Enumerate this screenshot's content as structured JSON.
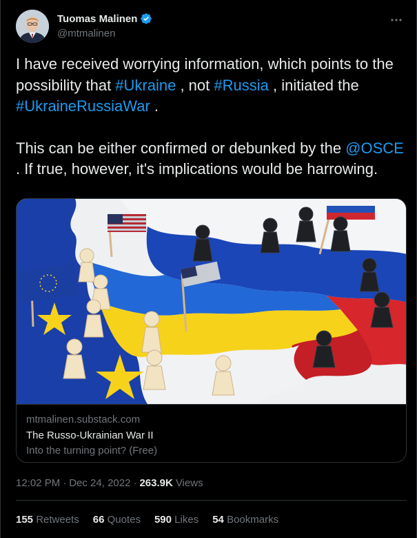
{
  "author": {
    "display_name": "Tuomas Malinen",
    "handle": "@mtmalinen",
    "avatar_icon": "profile-photo",
    "verified_icon": "verified-badge-icon"
  },
  "tweet": {
    "p1_before_ukraine": "I have received worrying information, which points to the possibility that ",
    "hashtag_ukraine": "#Ukraine",
    "p1_between": " , not ",
    "hashtag_russia": "#Russia",
    "p1_after_russia": " , initiated the ",
    "hashtag_war": "#UkraineRussiaWar",
    "p1_end": " .",
    "p2_before_mention": "This can be either confirmed or debunked by the ",
    "mention_osce": "@OSCE",
    "p2_after_mention": " . If true, however, it's implications would  be harrowing."
  },
  "card": {
    "domain": "mtmalinen.substack.com",
    "title": "The Russo-Ukrainian War II",
    "description": "Into the turning point? (Free)"
  },
  "meta": {
    "time": "12:02 PM",
    "separator": "·",
    "date": "Dec 24, 2022",
    "views_count": "263.9K",
    "views_label": "Views"
  },
  "stats": {
    "retweets_count": "155",
    "retweets_label": "Retweets",
    "quotes_count": "66",
    "quotes_label": "Quotes",
    "likes_count": "590",
    "likes_label": "Likes",
    "bookmarks_count": "54",
    "bookmarks_label": "Bookmarks"
  },
  "colors": {
    "background": "#000000",
    "text": "#e7e9ea",
    "secondary": "#71767b",
    "link": "#1d9bf0",
    "border": "#2f3336"
  }
}
